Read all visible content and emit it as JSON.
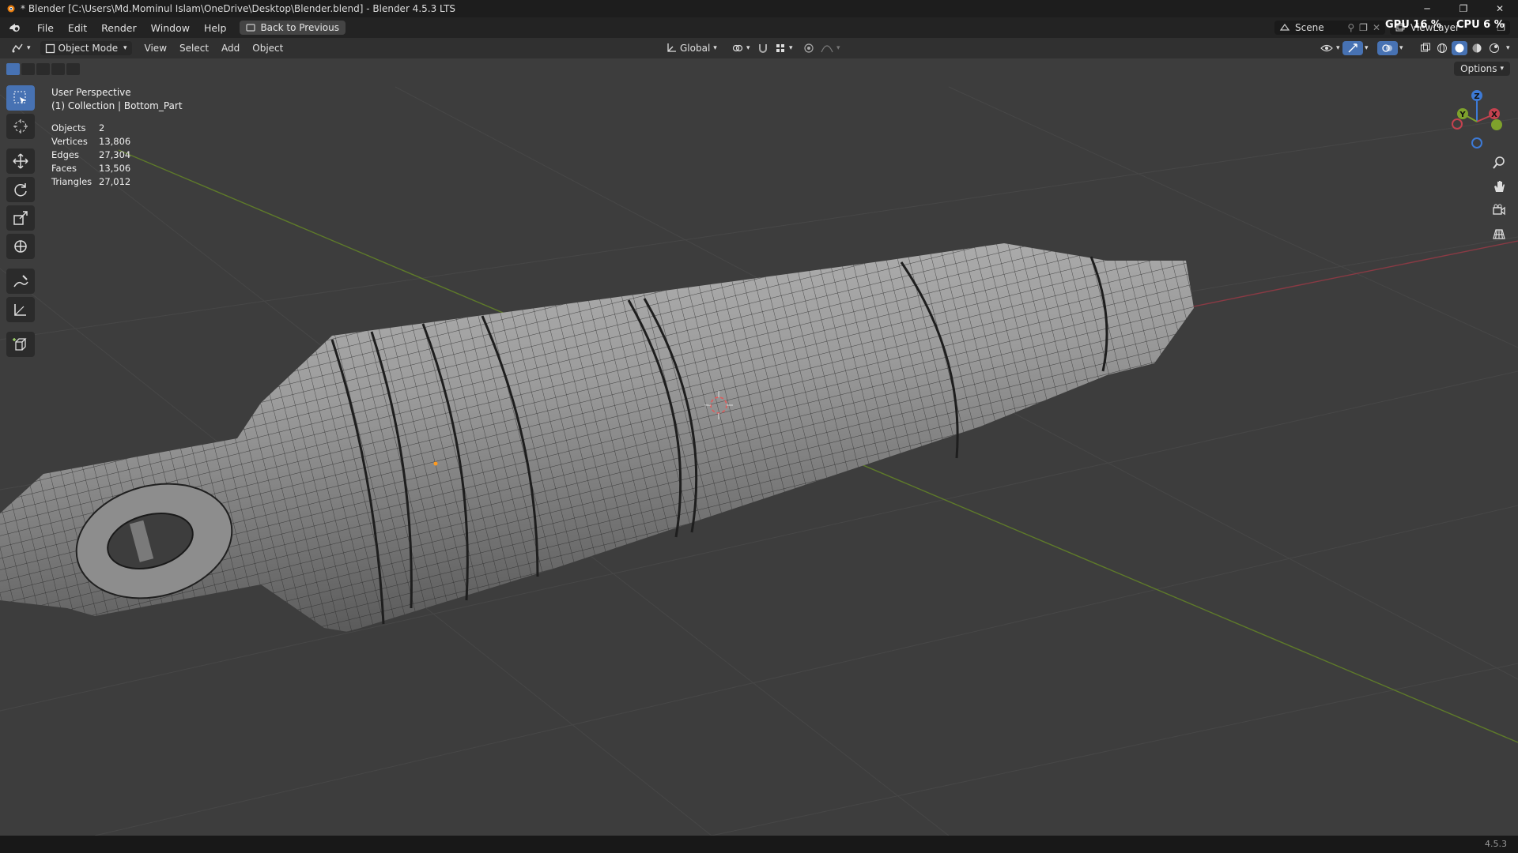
{
  "window": {
    "title": "* Blender [C:\\Users\\Md.Mominul Islam\\OneDrive\\Desktop\\Blender.blend] - Blender 4.5.3 LTS",
    "minimize": "─",
    "restore": "❐",
    "close": "✕"
  },
  "menubar": {
    "items": [
      "File",
      "Edit",
      "Render",
      "Window",
      "Help"
    ],
    "back_button": "Back to Previous",
    "scene": "Scene",
    "viewlayer": "ViewLayer",
    "gpu_label": "GPU",
    "gpu_value": "16 %",
    "cpu_label": "CPU",
    "cpu_value": "6 %"
  },
  "header": {
    "mode": "Object Mode",
    "menus": [
      "View",
      "Select",
      "Add",
      "Object"
    ],
    "orientation": "Global"
  },
  "viewport": {
    "options": "Options",
    "view_name": "User Perspective",
    "collection": "(1) Collection | Bottom_Part",
    "stats": [
      {
        "label": "Objects",
        "value": "2"
      },
      {
        "label": "Vertices",
        "value": "13,806"
      },
      {
        "label": "Edges",
        "value": "27,304"
      },
      {
        "label": "Faces",
        "value": "13,506"
      },
      {
        "label": "Triangles",
        "value": "27,012"
      }
    ],
    "gizmo": {
      "x": "X",
      "y": "Y",
      "z": "Z"
    }
  },
  "tools": [
    "select-box",
    "cursor",
    "move",
    "rotate",
    "scale",
    "transform",
    "annotate",
    "measure",
    "add-cube"
  ],
  "colors": {
    "accent": "#4772b3",
    "x_axis": "#c4424f",
    "y_axis": "#7ea22c",
    "z_axis": "#3d7ad6",
    "background": "#3d3d3d"
  },
  "statusbar": {
    "version": "4.5.3"
  }
}
